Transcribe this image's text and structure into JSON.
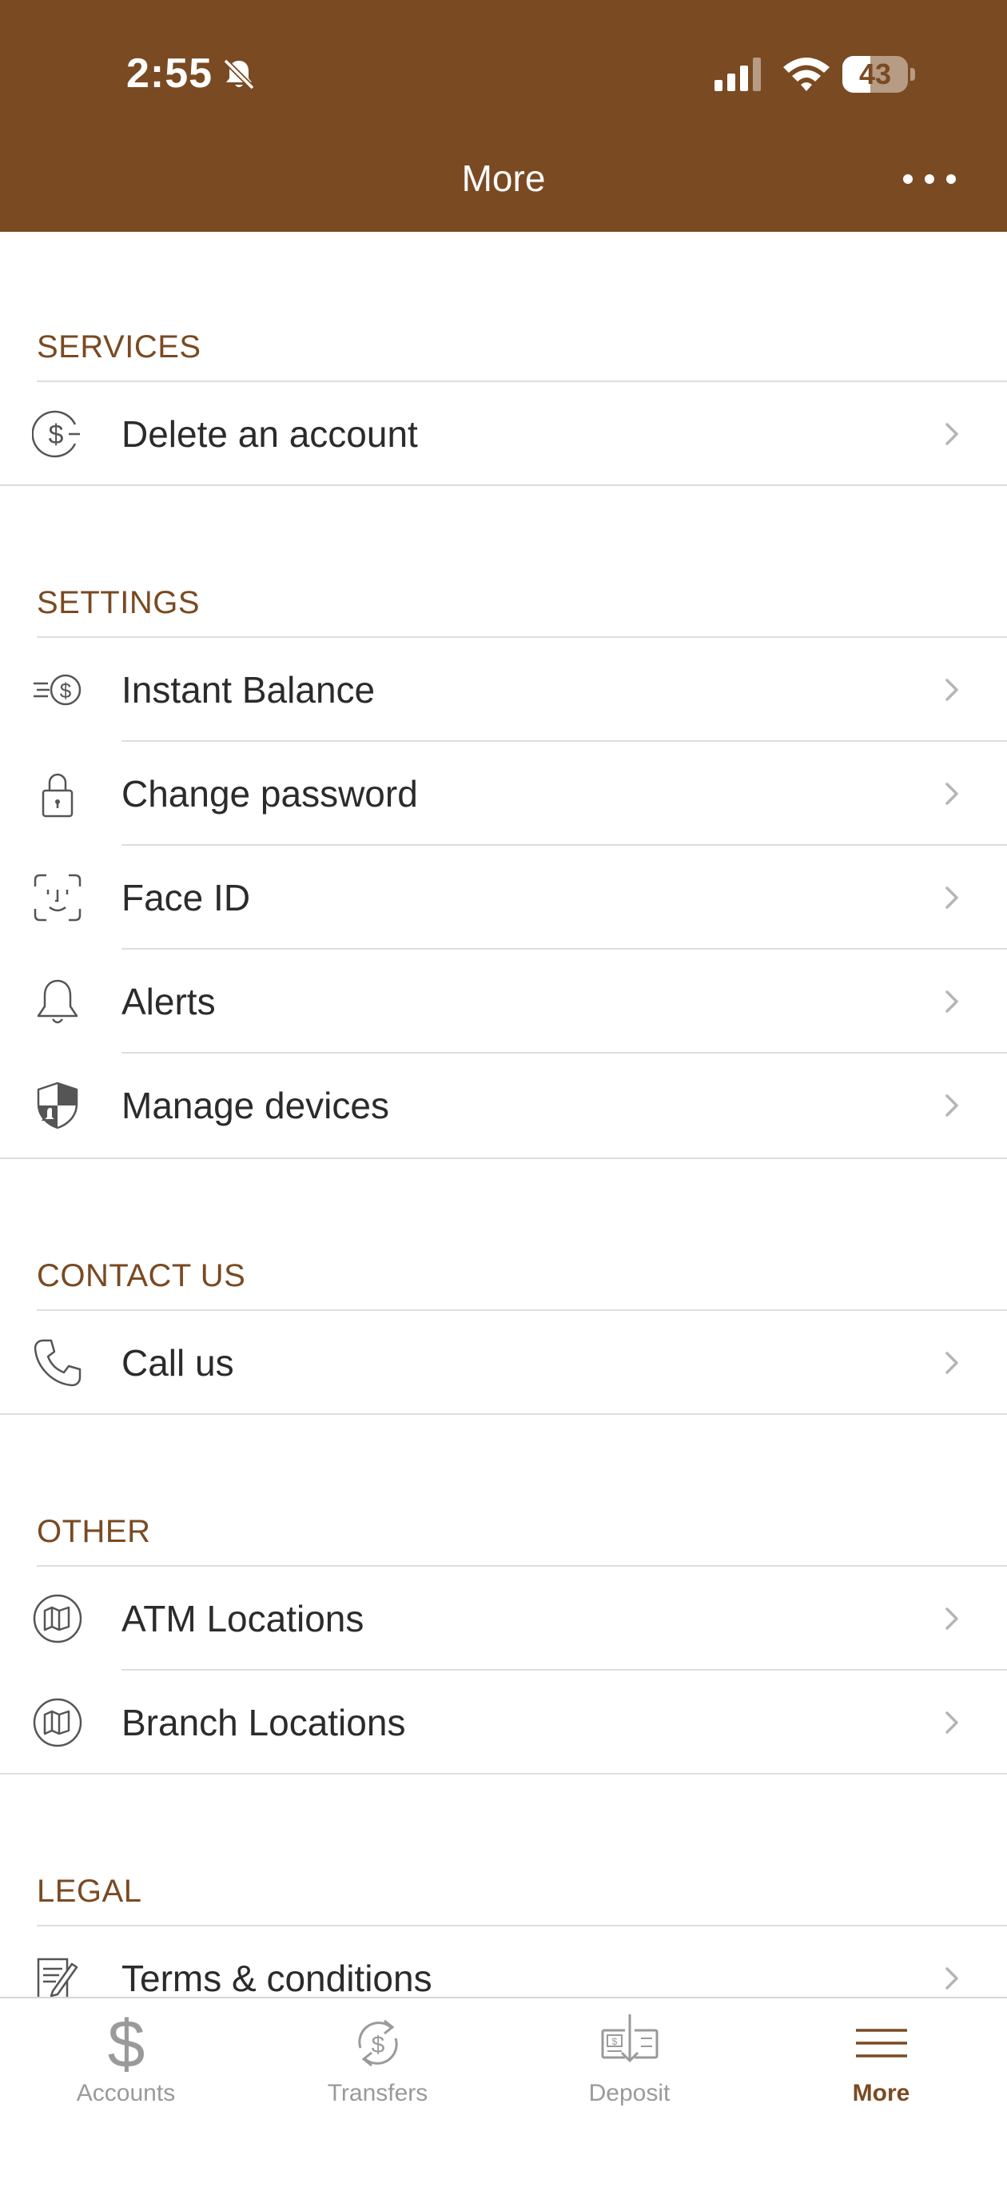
{
  "status_bar": {
    "time": "2:55",
    "battery": "43",
    "battery_level": 0.43
  },
  "header": {
    "title": "More"
  },
  "sections": [
    {
      "title": "SERVICES",
      "items": [
        {
          "label": "Delete an account",
          "icon": "dollar-circle-icon"
        }
      ]
    },
    {
      "title": "SETTINGS",
      "items": [
        {
          "label": "Instant Balance",
          "icon": "instant-balance-icon"
        },
        {
          "label": "Change password",
          "icon": "lock-icon"
        },
        {
          "label": "Face ID",
          "icon": "face-id-icon"
        },
        {
          "label": "Alerts",
          "icon": "bell-icon"
        },
        {
          "label": "Manage devices",
          "icon": "shield-icon"
        }
      ]
    },
    {
      "title": "CONTACT US",
      "items": [
        {
          "label": "Call us",
          "icon": "phone-icon"
        }
      ]
    },
    {
      "title": "OTHER",
      "items": [
        {
          "label": "ATM Locations",
          "icon": "map-icon"
        },
        {
          "label": "Branch Locations",
          "icon": "map-icon"
        }
      ]
    },
    {
      "title": "LEGAL",
      "items": [
        {
          "label": "Terms & conditions",
          "icon": "document-icon"
        }
      ]
    }
  ],
  "tabbar": {
    "tabs": [
      {
        "label": "Accounts",
        "icon": "dollar-icon"
      },
      {
        "label": "Transfers",
        "icon": "transfer-icon"
      },
      {
        "label": "Deposit",
        "icon": "check-deposit-icon"
      },
      {
        "label": "More",
        "icon": "menu-icon"
      }
    ],
    "active": "More"
  },
  "colors": {
    "brand": "#7a4a22",
    "header_bg": "#7a4a22",
    "inactive_tab": "#9a9a9a",
    "divider": "#dedede"
  }
}
